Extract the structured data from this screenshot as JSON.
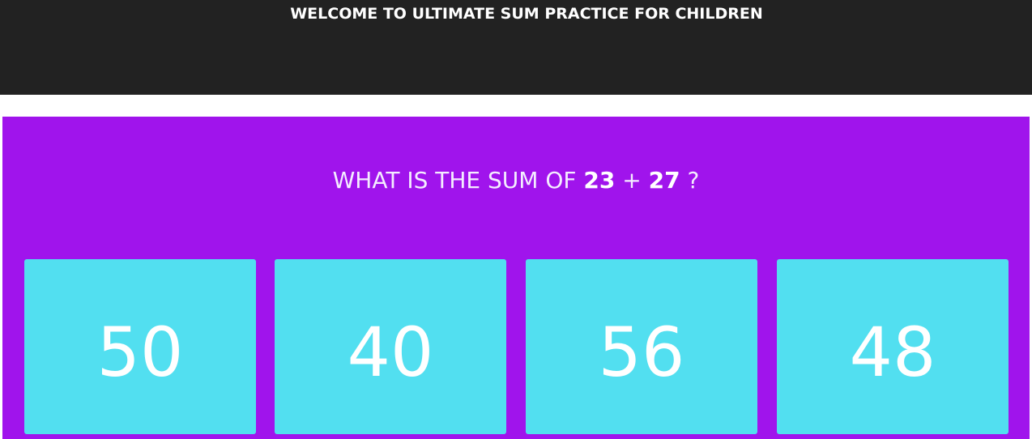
{
  "header": {
    "title": "WELCOME TO ULTIMATE SUM PRACTICE FOR CHILDREN"
  },
  "question": {
    "prefix": "WHAT IS THE SUM OF",
    "operand_a": "23",
    "operator": "+",
    "operand_b": "27",
    "suffix": "?"
  },
  "answers": [
    {
      "label": "50"
    },
    {
      "label": "40"
    },
    {
      "label": "56"
    },
    {
      "label": "48"
    }
  ],
  "colors": {
    "header_bg": "#222222",
    "panel_bg": "#a014ec",
    "answer_bg": "#52dff0"
  }
}
